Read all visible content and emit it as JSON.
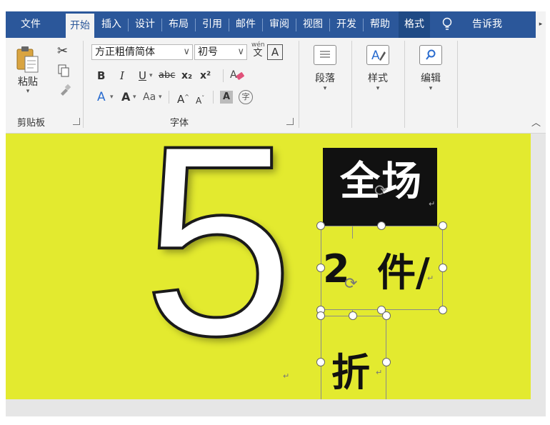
{
  "tabs": {
    "file": "文件",
    "home": "开始",
    "insert": "插入",
    "design": "设计",
    "layout": "布局",
    "references": "引用",
    "mailings": "邮件",
    "review": "审阅",
    "view": "视图",
    "developer": "开发",
    "help": "帮助",
    "format": "格式",
    "tell_me": "告诉我"
  },
  "clipboard": {
    "paste_label": "粘贴",
    "group_label": "剪贴板"
  },
  "font": {
    "font_name": "方正粗倩简体",
    "font_size": "初号",
    "bold": "B",
    "italic": "I",
    "underline": "U",
    "strikethrough": "abc",
    "subscript": "x₂",
    "superscript": "x²",
    "font_color": "A",
    "change_case": "Aa",
    "grow_font": "A",
    "shrink_font": "A",
    "char_shading": "A",
    "enclose_char": "字",
    "phonetic_top": "wén",
    "phonetic_bottom": "文",
    "border_char": "A",
    "text_effect": "A",
    "highlight": "A",
    "group_label": "字体"
  },
  "paragraph": {
    "label": "段落"
  },
  "styles": {
    "label": "样式"
  },
  "editing": {
    "label": "编辑"
  },
  "document": {
    "big_number": "5",
    "box1_text": "全场",
    "box2_num": "2",
    "box2_char": "件/",
    "box3_text": "折",
    "para_mark": "↵"
  },
  "colors": {
    "ribbon_blue": "#2b579a",
    "canvas_yellow": "#e3ea2f"
  }
}
